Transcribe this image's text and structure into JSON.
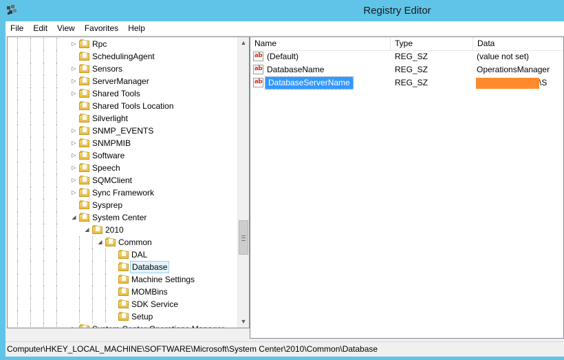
{
  "window": {
    "title": "Registry Editor",
    "app_icon": "registry-editor-icon",
    "accent": "#5fc4e8"
  },
  "menu": [
    "File",
    "Edit",
    "View",
    "Favorites",
    "Help"
  ],
  "tree": {
    "items": [
      {
        "label": "Rpc",
        "expander": "collapsed"
      },
      {
        "label": "SchedulingAgent",
        "expander": "none"
      },
      {
        "label": "Sensors",
        "expander": "collapsed"
      },
      {
        "label": "ServerManager",
        "expander": "collapsed"
      },
      {
        "label": "Shared Tools",
        "expander": "collapsed"
      },
      {
        "label": "Shared Tools Location",
        "expander": "none"
      },
      {
        "label": "Silverlight",
        "expander": "none"
      },
      {
        "label": "SNMP_EVENTS",
        "expander": "collapsed"
      },
      {
        "label": "SNMPMIB",
        "expander": "collapsed"
      },
      {
        "label": "Software",
        "expander": "collapsed"
      },
      {
        "label": "Speech",
        "expander": "collapsed"
      },
      {
        "label": "SQMClient",
        "expander": "collapsed"
      },
      {
        "label": "Sync Framework",
        "expander": "collapsed"
      },
      {
        "label": "Sysprep",
        "expander": "none"
      },
      {
        "label": "System Center",
        "expander": "expanded"
      },
      {
        "label": "2010",
        "expander": "expanded"
      },
      {
        "label": "Common",
        "expander": "expanded"
      },
      {
        "label": "DAL",
        "expander": "none"
      },
      {
        "label": "Database",
        "expander": "none",
        "selected": true
      },
      {
        "label": "Machine Settings",
        "expander": "none"
      },
      {
        "label": "MOMBins",
        "expander": "none"
      },
      {
        "label": "SDK Service",
        "expander": "none"
      },
      {
        "label": "Setup",
        "expander": "none"
      },
      {
        "label": "System Center Operations Manager",
        "expander": "collapsed"
      }
    ]
  },
  "values": {
    "columns": [
      "Name",
      "Type",
      "Data"
    ],
    "rows": [
      {
        "name": "(Default)",
        "type": "REG_SZ",
        "data": "(value not set)"
      },
      {
        "name": "DatabaseName",
        "type": "REG_SZ",
        "data": "OperationsManager"
      },
      {
        "name": "DatabaseServerName",
        "type": "REG_SZ",
        "data": "\\S",
        "selected": true,
        "redacted": true
      }
    ],
    "icon_text": "ab"
  },
  "status": {
    "path": "Computer\\HKEY_LOCAL_MACHINE\\SOFTWARE\\Microsoft\\System Center\\2010\\Common\\Database"
  },
  "scrollbar": {
    "up_icon": "chevron-up-icon",
    "down_icon": "chevron-down-icon"
  }
}
